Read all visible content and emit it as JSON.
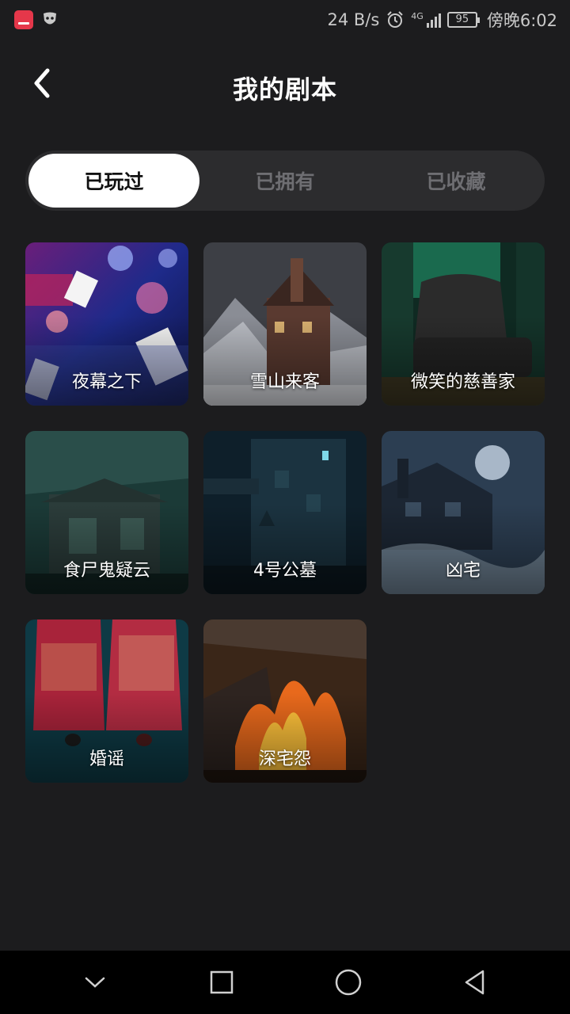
{
  "status_bar": {
    "network_speed": "24 B/s",
    "network_type": "4G",
    "battery": "95",
    "time": "傍晚6:02",
    "icons": [
      "huawei-appgallery-icon",
      "mask-icon",
      "alarm-icon",
      "signal-icon",
      "battery-icon"
    ]
  },
  "header": {
    "title": "我的剧本",
    "back_icon": "chevron-left-icon"
  },
  "tabs": [
    {
      "label": "已玩过",
      "active": true
    },
    {
      "label": "已拥有",
      "active": false
    },
    {
      "label": "已收藏",
      "active": false
    }
  ],
  "scripts": [
    {
      "title": "夜幕之下"
    },
    {
      "title": "雪山来客"
    },
    {
      "title": "微笑的慈善家"
    },
    {
      "title": "食尸鬼疑云"
    },
    {
      "title": "4号公墓"
    },
    {
      "title": "凶宅"
    },
    {
      "title": "婚谣"
    },
    {
      "title": "深宅怨"
    }
  ],
  "nav_bar": {
    "icons": [
      "chevron-down-icon",
      "square-icon",
      "circle-icon",
      "triangle-back-icon"
    ]
  },
  "colors": {
    "background": "#1c1c1e",
    "tab_track": "#2c2c2e",
    "tab_active": "#ffffff",
    "tab_inactive_text": "#6e6e72"
  }
}
